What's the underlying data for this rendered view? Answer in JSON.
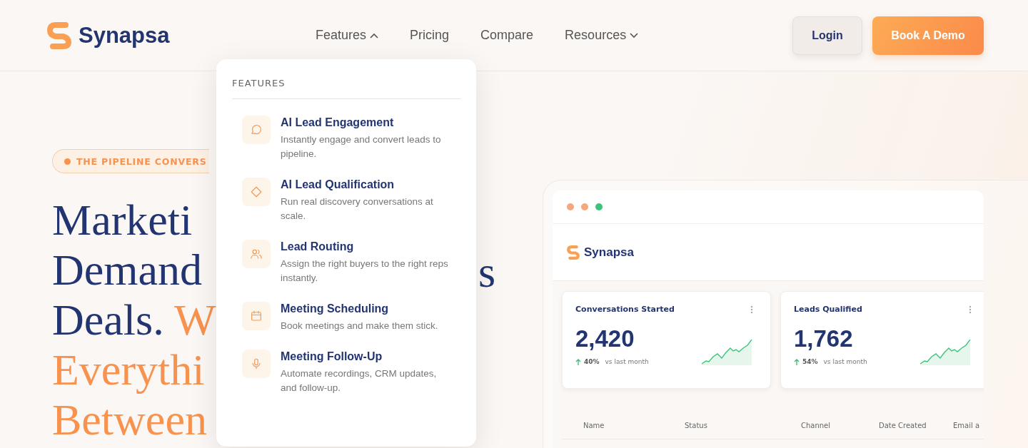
{
  "header": {
    "brand": "Synapsa",
    "nav": [
      {
        "label": "Features",
        "kind": "dropdown",
        "expanded": true
      },
      {
        "label": "Pricing",
        "kind": "link"
      },
      {
        "label": "Compare",
        "kind": "link"
      },
      {
        "label": "Resources",
        "kind": "dropdown",
        "expanded": false
      }
    ],
    "login": "Login",
    "cta": "Book A Demo"
  },
  "features_menu": {
    "heading": "FEATURES",
    "items": [
      {
        "title": "AI Lead Engagement",
        "description": "Instantly engage and convert leads to pipeline."
      },
      {
        "title": "AI Lead Qualification",
        "description": "Run real discovery conversations at scale."
      },
      {
        "title": "Lead Routing",
        "description": "Assign the right buyers to the right reps instantly."
      },
      {
        "title": "Meeting Scheduling",
        "description": "Book meetings and make them stick."
      },
      {
        "title": "Meeting Follow-Up",
        "description": "Automate recordings, CRM updates, and follow-up."
      }
    ]
  },
  "hero": {
    "badge": "THE PIPELINE CONVERS",
    "lines": [
      {
        "text": "Marketi",
        "accent": false
      },
      {
        "text": "Demand",
        "accent": false
      },
      {
        "text": "Deals.",
        "accent": false,
        "extra": "W"
      },
      {
        "text": "Everythi",
        "accent": true
      },
      {
        "text": "Between",
        "accent": true
      }
    ],
    "fragment": "s"
  },
  "dashboard": {
    "window_dots": [
      {
        "color": "#f7a77a"
      },
      {
        "color": "#f7a77a"
      },
      {
        "color": "#3cc47c"
      }
    ],
    "brand": "Synapsa",
    "cards": [
      {
        "title": "Conversations Started",
        "value": "2,420",
        "change": "40%",
        "comparison": "vs last month"
      },
      {
        "title": "Leads Qualified",
        "value": "1,762",
        "change": "54%",
        "comparison": "vs last month"
      }
    ],
    "table": {
      "columns": [
        "Name",
        "Status",
        "Channel",
        "Date Created",
        "Email a"
      ]
    }
  }
}
